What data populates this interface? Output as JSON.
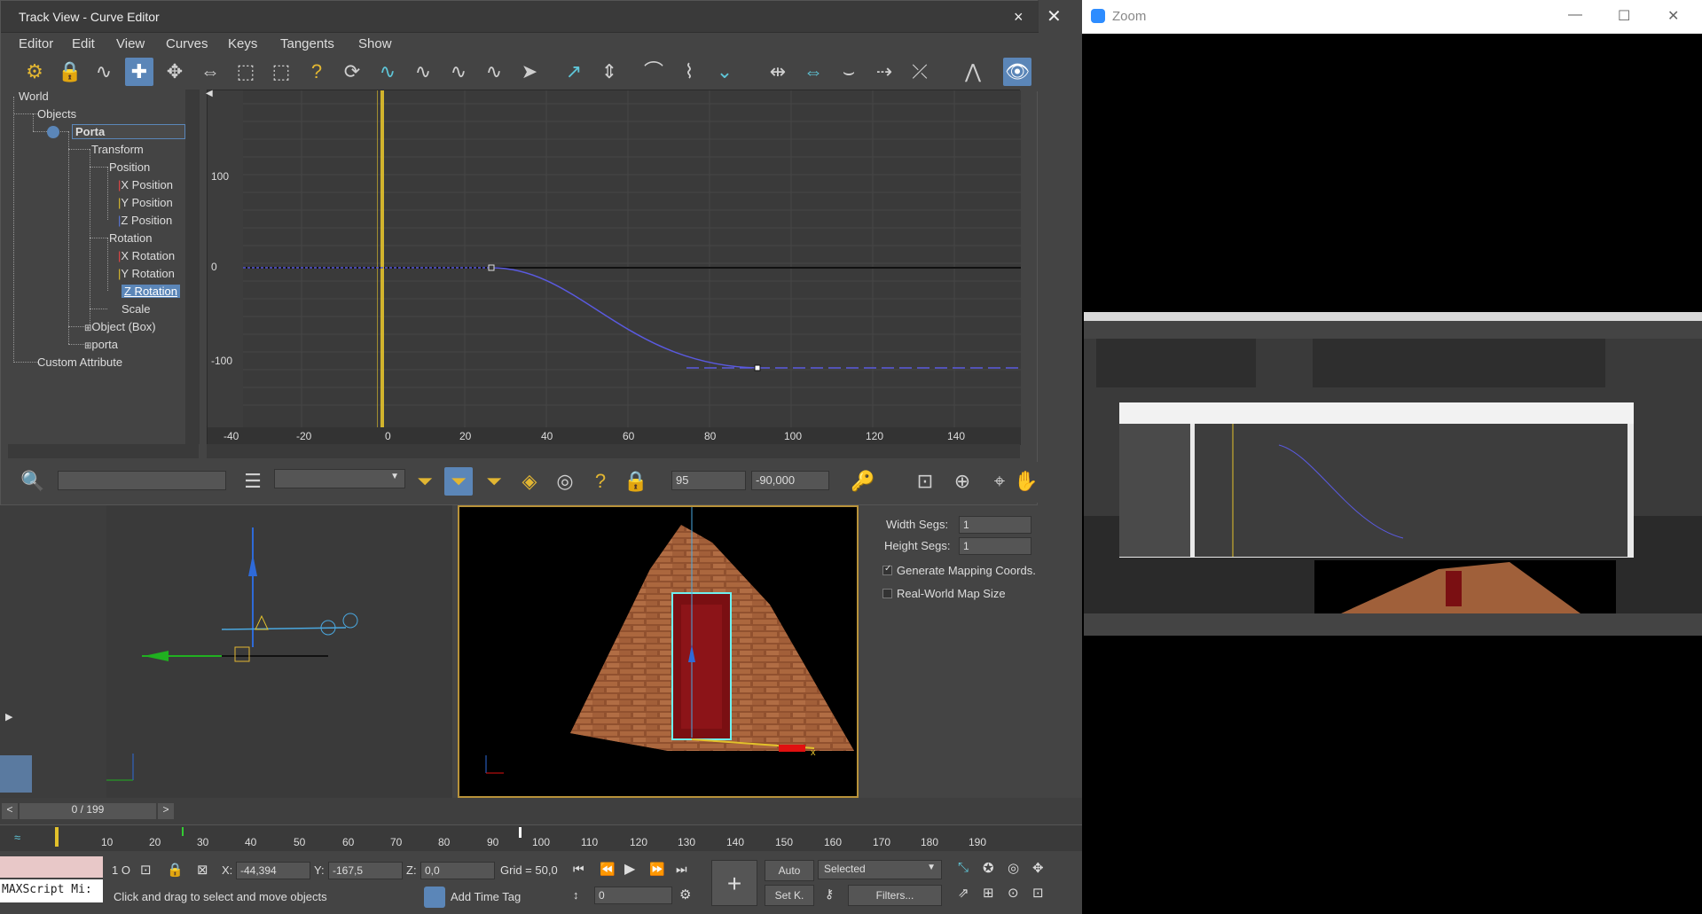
{
  "track_view": {
    "title": "Track View - Curve Editor",
    "close": "×",
    "menu": [
      "Editor",
      "Edit",
      "View",
      "Curves",
      "Keys",
      "Tangents",
      "Show"
    ],
    "tree": {
      "world": "World",
      "objects": "Objects",
      "porta": "Porta",
      "transform": "Transform",
      "position": "Position",
      "x_position": "X Position",
      "y_position": "Y Position",
      "z_position": "Z Position",
      "rotation": "Rotation",
      "x_rotation": "X Rotation",
      "y_rotation": "Y Rotation",
      "z_rotation": "Z Rotation",
      "scale": "Scale",
      "object_box": "Object (Box)",
      "porta_lower": "porta",
      "custom_attribute": "Custom Attribute"
    },
    "graph": {
      "y_labels": [
        "100",
        "0",
        "-100"
      ],
      "x_labels": [
        "-40",
        "-20",
        "0",
        "20",
        "40",
        "60",
        "80",
        "100",
        "120",
        "140"
      ]
    },
    "bottom": {
      "frame_value": "95",
      "key_value": "-90,000"
    }
  },
  "command_panel": {
    "width_segs_label": "Width Segs:",
    "width_segs_value": "1",
    "height_segs_label": "Height Segs:",
    "height_segs_value": "1",
    "gen_mapping": "Generate Mapping Coords.",
    "real_world": "Real-World Map Size"
  },
  "time_slider": {
    "label": "0 / 199",
    "prev": "<",
    "next": ">"
  },
  "timeline": {
    "ticks": [
      "10",
      "20",
      "30",
      "40",
      "50",
      "60",
      "70",
      "80",
      "90",
      "100",
      "110",
      "120",
      "130",
      "140",
      "150",
      "160",
      "170",
      "180",
      "190"
    ]
  },
  "status": {
    "maxscript": "MAXScript Mi:",
    "selected_count": "1 O",
    "x_label": "X:",
    "x_value": "-44,394",
    "y_label": "Y:",
    "y_value": "-167,5",
    "z_label": "Z:",
    "z_value": "0,0",
    "grid": "Grid = 50,0",
    "prompt": "Click and drag to select and move objects",
    "add_time_tag": "Add Time Tag",
    "auto": "Auto",
    "set_key": "Set K.",
    "selected": "Selected",
    "filters": "Filters...",
    "frame": "0"
  },
  "zoom": {
    "title": "Zoom",
    "minimize": "—",
    "maximize": "☐",
    "close": "✕"
  },
  "colors": {
    "accent": "#5b86b8",
    "curve": "#5a5ae0",
    "time_marker": "#e2c12b"
  }
}
